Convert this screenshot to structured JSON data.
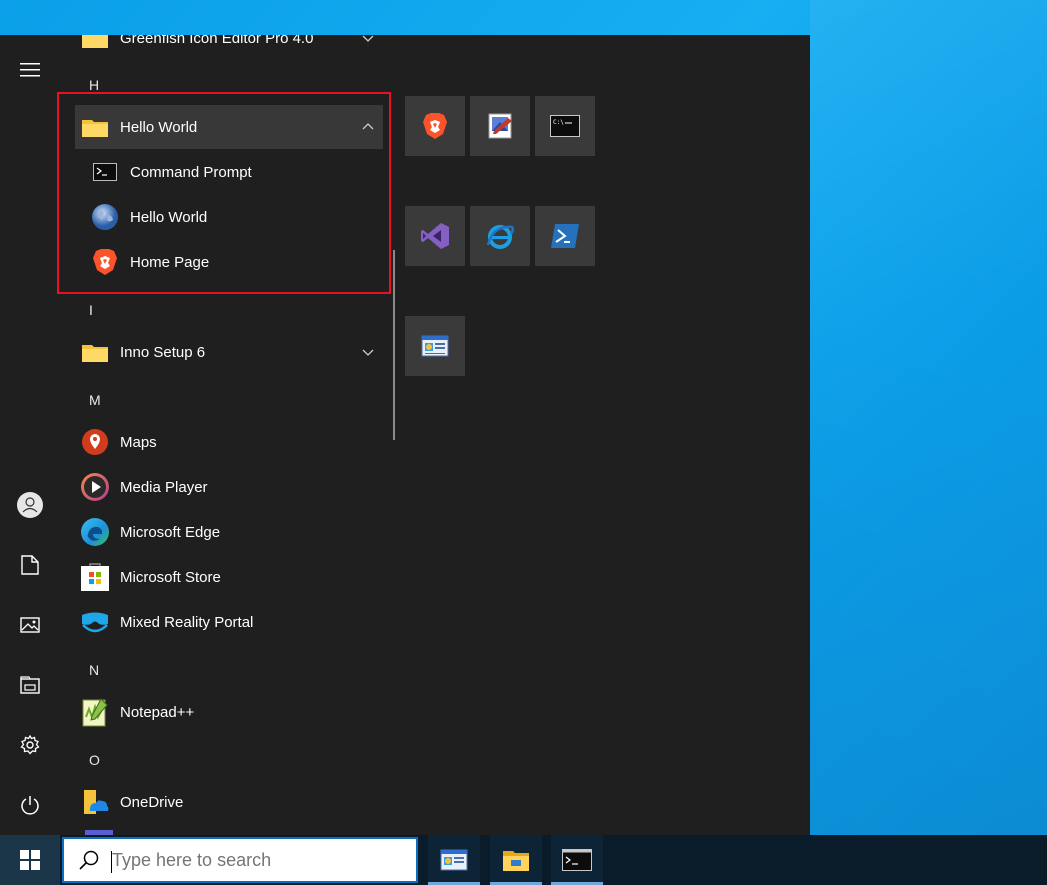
{
  "start_menu": {
    "groups": [
      {
        "letter": "H"
      },
      {
        "letter": "I"
      },
      {
        "letter": "M"
      },
      {
        "letter": "N"
      },
      {
        "letter": "O"
      }
    ],
    "apps": {
      "greenfish": "Greenfish Icon Editor Pro 4.0",
      "hello_world_folder": "Hello World",
      "command_prompt": "Command Prompt",
      "hello_world": "Hello World",
      "home_page": "Home Page",
      "inno_setup": "Inno Setup 6",
      "maps": "Maps",
      "media_player": "Media Player",
      "microsoft_edge": "Microsoft Edge",
      "microsoft_store": "Microsoft Store",
      "mixed_reality": "Mixed Reality Portal",
      "notepadpp": "Notepad++",
      "onedrive": "OneDrive"
    },
    "rail": [
      "hamburger-icon",
      "user-icon",
      "documents-icon",
      "pictures-icon",
      "file-explorer-icon",
      "settings-icon",
      "power-icon"
    ],
    "tiles": [
      "brave-icon",
      "greenfish-icon",
      "cmd-icon",
      "visual-studio-icon",
      "ie-icon",
      "powershell-icon",
      "control-panel-icon"
    ]
  },
  "taskbar": {
    "search_placeholder": "Type here to search",
    "apps": [
      "control-panel-icon",
      "file-explorer-icon",
      "cmd-icon"
    ]
  },
  "colors": {
    "highlight_border": "#e81123",
    "menu_bg": "#1f1f1f",
    "accent": "#0b6ec2"
  }
}
